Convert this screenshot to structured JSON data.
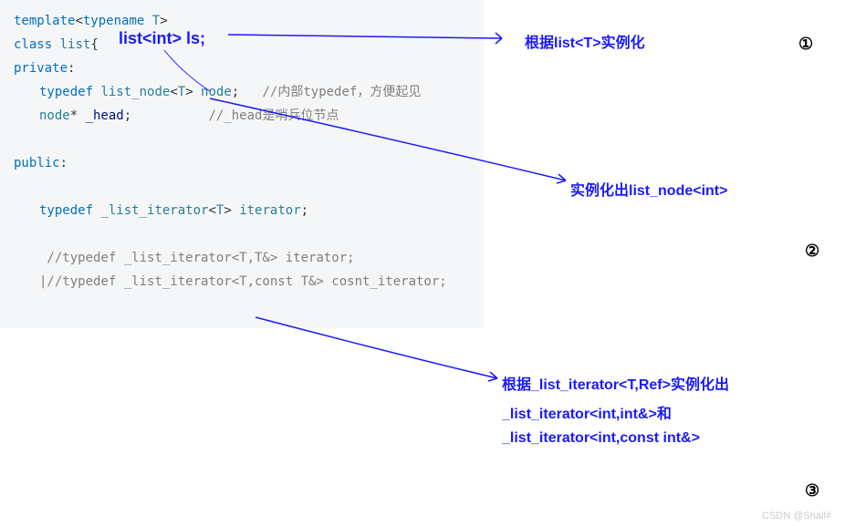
{
  "code": {
    "line1_template": "template",
    "line1_typename": "typename",
    "line1_T": "T",
    "line2_class": "class",
    "line2_list": "list",
    "line3_private": "private",
    "line4_typedef": "typedef",
    "line4_listnode": "list_node",
    "line4_T": "T",
    "line4_node": "node",
    "line4_comment": "//内部typedef，方便起见",
    "line5_node": "node",
    "line5_head": "_head",
    "line5_comment": "//_head是哨兵位节点",
    "line7_public": "public",
    "line9_typedef": "typedef",
    "line9_iter": "_list_iterator",
    "line9_T": "T",
    "line9_iterator": "iterator",
    "line11_comment": " //typedef _list_iterator<T,T&> iterator;",
    "line12_comment": "|//typedef _list_iterator<T,const T&> cosnt_iterator;"
  },
  "annotations": {
    "inline_listint": "list<int> ls;",
    "note1": "根据list<T>实例化",
    "note2": "实例化出list_node<int>",
    "note3_l1": "根据_list_iterator<T,Ref>实例化出",
    "note3_l2": "_list_iterator<int,int&>和",
    "note3_l3": "_list_iterator<int,const int&>",
    "circ1": "①",
    "circ2": "②",
    "circ3": "③",
    "watermark": "CSDN @Shall#"
  }
}
